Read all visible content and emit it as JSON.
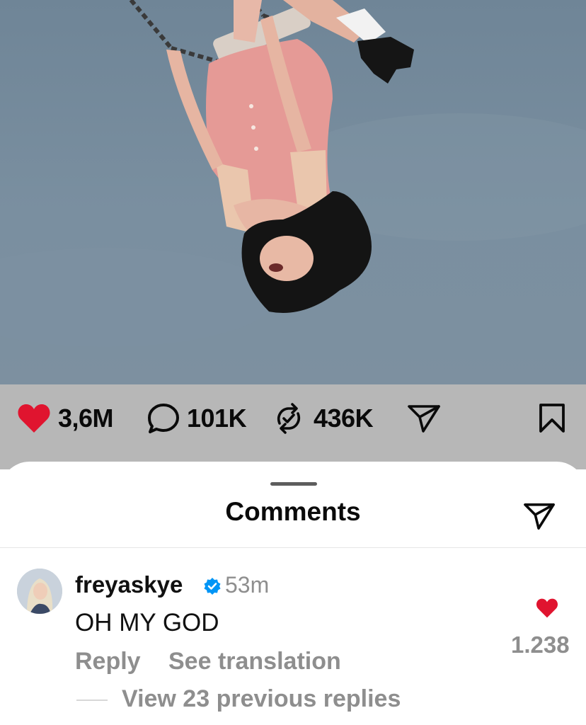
{
  "post": {
    "image_description": "person hanging upside down from a swing against a blue sky",
    "stats": {
      "likes": "3,6M",
      "comments": "101K",
      "reposts": "436K"
    },
    "colors": {
      "like_red": "#e0142f",
      "bar_background": "#b7b7b7"
    }
  },
  "comments_sheet": {
    "title": "Comments",
    "comment": {
      "username": "freyaskye",
      "verified": true,
      "time": "53m",
      "text": "OH MY GOD",
      "reply_label": "Reply",
      "translate_label": "See translation",
      "like_count": "1.238",
      "view_replies_label": "View 23 previous replies"
    }
  },
  "icons": [
    "heart-icon",
    "comment-icon",
    "repost-icon",
    "share-icon",
    "bookmark-icon",
    "verified-icon",
    "like-heart-icon"
  ]
}
